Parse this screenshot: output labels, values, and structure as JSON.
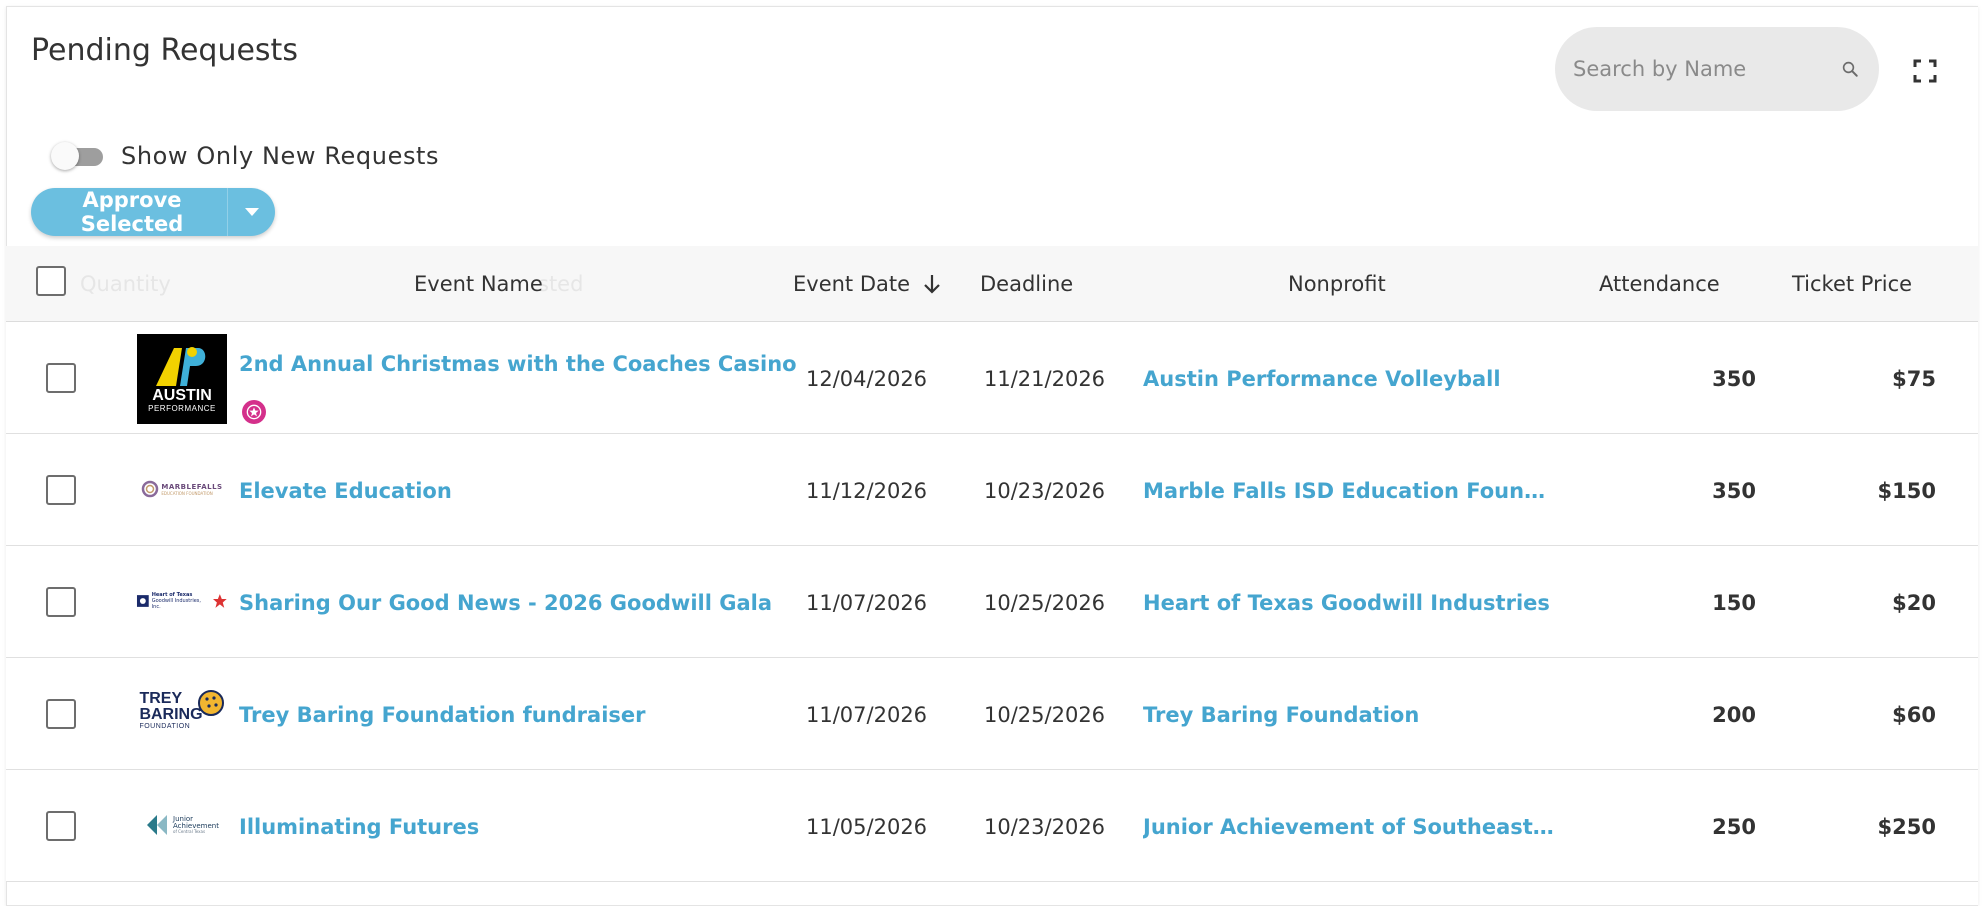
{
  "page": {
    "title": "Pending Requests"
  },
  "search": {
    "placeholder": "Search by Name"
  },
  "filters": {
    "show_new_label": "Show Only New Requests",
    "show_new_enabled": false
  },
  "actions": {
    "approve_label": "Approve Selected"
  },
  "table": {
    "columns": {
      "ghost_quantity": "Quantity",
      "ghost_requested": "sted",
      "event_name": "Event Name",
      "event_date": "Event Date",
      "deadline": "Deadline",
      "nonprofit": "Nonprofit",
      "attendance": "Attendance",
      "ticket_price": "Ticket Price"
    },
    "sort": {
      "column": "Event Date",
      "direction": "descending"
    },
    "rows": [
      {
        "event_name": "2nd Annual Christmas with the Coaches Casino",
        "event_date": "12/04/2026",
        "deadline": "11/21/2026",
        "nonprofit": "Austin Performance Volleyball",
        "attendance": "350",
        "ticket_price": "$75",
        "logo": {
          "line1": "AUSTIN",
          "line2": "PERFORMANCE"
        },
        "badge": "star-badge-icon"
      },
      {
        "event_name": "Elevate Education",
        "event_date": "11/12/2026",
        "deadline": "10/23/2026",
        "nonprofit": "Marble Falls ISD Education Foundation",
        "attendance": "350",
        "ticket_price": "$150",
        "logo": {
          "line1": "MARBLEFALLS",
          "line2": "EDUCATION FOUNDATION"
        }
      },
      {
        "event_name": "Sharing Our Good News - 2026 Goodwill Gala",
        "event_date": "11/07/2026",
        "deadline": "10/25/2026",
        "nonprofit": "Heart of Texas Goodwill Industries",
        "attendance": "150",
        "ticket_price": "$20",
        "logo": {
          "line1": "Heart of Texas",
          "line2": "Goodwill Industries, Inc."
        }
      },
      {
        "event_name": "Trey Baring Foundation fundraiser",
        "event_date": "11/07/2026",
        "deadline": "10/25/2026",
        "nonprofit": "Trey Baring Foundation",
        "attendance": "200",
        "ticket_price": "$60",
        "logo": {
          "line1": "TREY",
          "line2": "BARING",
          "line3": "FOUNDATION"
        }
      },
      {
        "event_name": "Illuminating Futures",
        "event_date": "11/05/2026",
        "deadline": "10/23/2026",
        "nonprofit": "Junior Achievement of Southeast Texa...",
        "attendance": "250",
        "ticket_price": "$250",
        "logo": {
          "line1": "Junior",
          "line2": "Achievement",
          "line3": "of Central Texas"
        }
      }
    ]
  },
  "colors": {
    "accent": "#45a5cf",
    "button": "#6bbfe0",
    "badge": "#d4308b"
  }
}
